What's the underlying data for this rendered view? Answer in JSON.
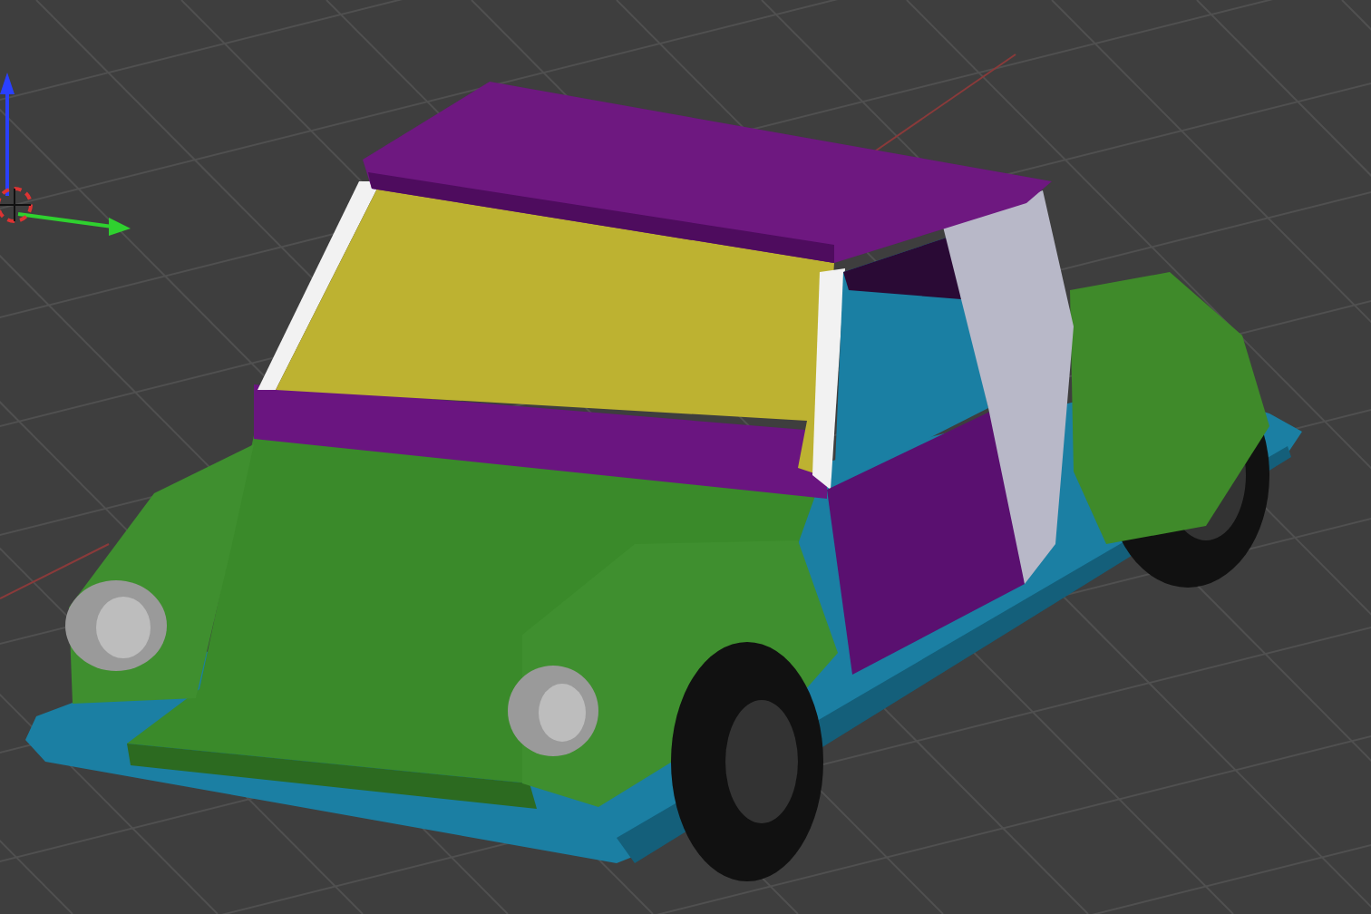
{
  "viewport": {
    "grid_visible": true,
    "axes_visible": true,
    "cursor_visible": true
  }
}
